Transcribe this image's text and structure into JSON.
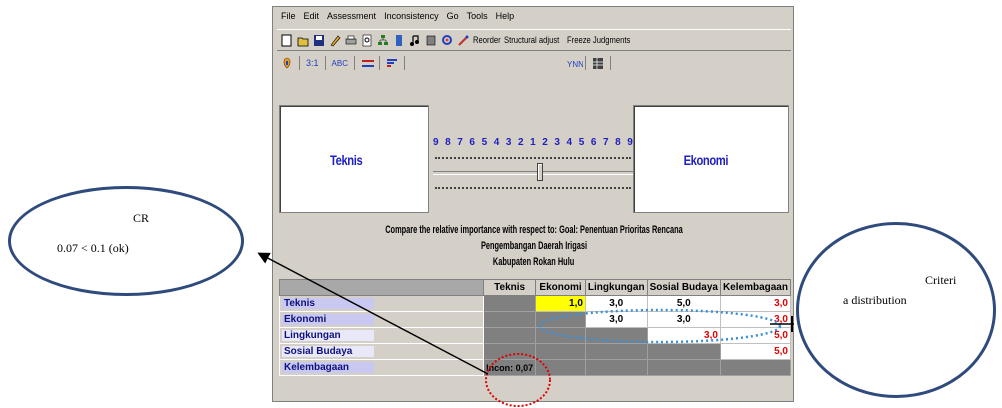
{
  "menu": {
    "items": [
      "File",
      "Edit",
      "Assessment",
      "Inconsistency",
      "Go",
      "Tools",
      "Help"
    ]
  },
  "toolbar": {
    "reorder": "Reorder",
    "structural_adjust": "Structural adjust",
    "freeze_judgments": "Freeze Judgments",
    "mode_numeric": "3:1",
    "mode_verbal": "ABC"
  },
  "compare_panel": {
    "left_label": "Teknis",
    "right_label": "Ekonomi",
    "scale_numbers": [
      "9",
      "8",
      "7",
      "6",
      "5",
      "4",
      "3",
      "2",
      "1",
      "2",
      "3",
      "4",
      "5",
      "6",
      "7",
      "8",
      "9"
    ],
    "slider_value": 1
  },
  "prompt": {
    "line1": "Compare the relative importance  with respect to: Goal: Penentuan Prioritas Rencana Pengembangan Daerah Irigasi",
    "line2": "Kabupaten Rokan Hulu"
  },
  "matrix": {
    "columns": [
      "Teknis",
      "Ekonomi",
      "Lingkungan",
      "Sosial Budaya",
      "Kelembagaan"
    ],
    "rows": [
      {
        "label": "Teknis",
        "cells": [
          "",
          "1,0",
          "3,0",
          "5,0",
          "3,0"
        ]
      },
      {
        "label": "Ekonomi",
        "cells": [
          "",
          "",
          "3,0",
          "3,0",
          "3,0"
        ]
      },
      {
        "label": "Lingkungan",
        "cells": [
          "",
          "",
          "",
          "3,0",
          "5,0"
        ]
      },
      {
        "label": "Sosial Budaya",
        "cells": [
          "",
          "",
          "",
          "",
          "5,0"
        ]
      },
      {
        "label": "Kelembagaan",
        "cells": [
          "Incon: 0,07",
          "",
          "",
          "",
          ""
        ]
      }
    ]
  },
  "annotations": {
    "cr_title": "CR",
    "cr_value": "0.07 < 0.1 (ok)",
    "criteria_line1": "Criteri",
    "criteria_line2": "a distribution"
  },
  "colors": {
    "bubble_border": "#2f4a7c",
    "accent_blue": "#2020c0",
    "inverse_red": "#e00000",
    "highlight_yellow": "#ffff00",
    "incon_circle": "#e00000",
    "dist_ellipse": "#3a8fd6"
  }
}
